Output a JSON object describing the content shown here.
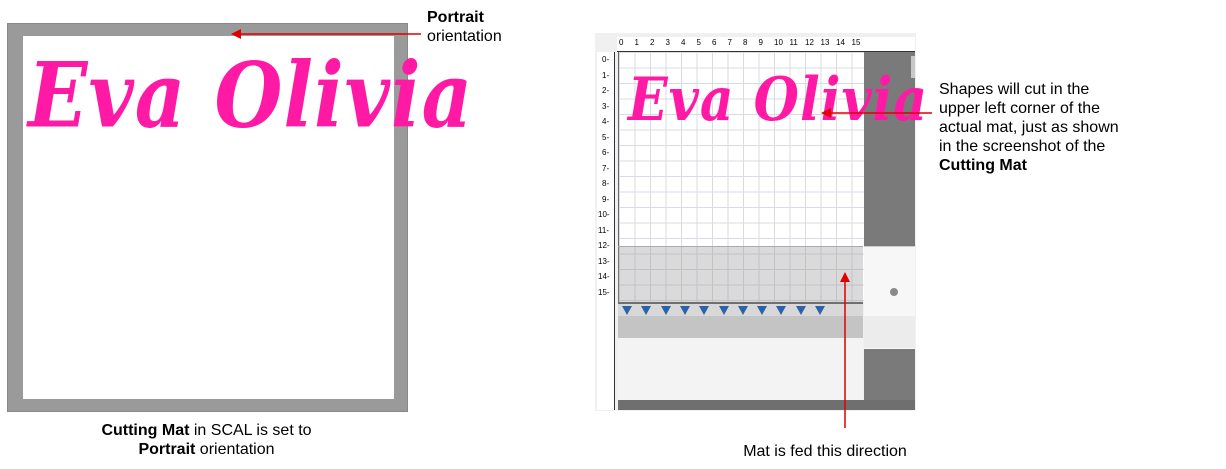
{
  "left": {
    "mat_text": "Eva Olivia",
    "caption_line1_bold": "Cutting Mat",
    "caption_line1_rest": " in SCAL is set to",
    "caption_line2_bold": "Portrait",
    "caption_line2_rest": " orientation",
    "callout_bold": "Portrait",
    "callout_rest": "orientation"
  },
  "right": {
    "mat_text": "Eva Olivia",
    "ruler_top": [
      "0",
      "1",
      "2",
      "3",
      "4",
      "5",
      "6",
      "7",
      "8",
      "9",
      "10",
      "11",
      "12",
      "13",
      "14",
      "15"
    ],
    "ruler_left": [
      "0",
      "1",
      "2",
      "3",
      "4",
      "5",
      "6",
      "7",
      "8",
      "9",
      "10",
      "11",
      "12",
      "13",
      "14",
      "15"
    ],
    "callout_lines": [
      "Shapes will cut in the",
      "upper left corner of the",
      "actual mat, just as shown",
      "in the screenshot of the"
    ],
    "callout_bold": "Cutting Mat",
    "bottom_caption": "Mat is fed this direction"
  },
  "colors": {
    "script_pink": "#ff1aa6",
    "arrow_red": "#e00000",
    "roller_blue": "#2d62a8"
  }
}
